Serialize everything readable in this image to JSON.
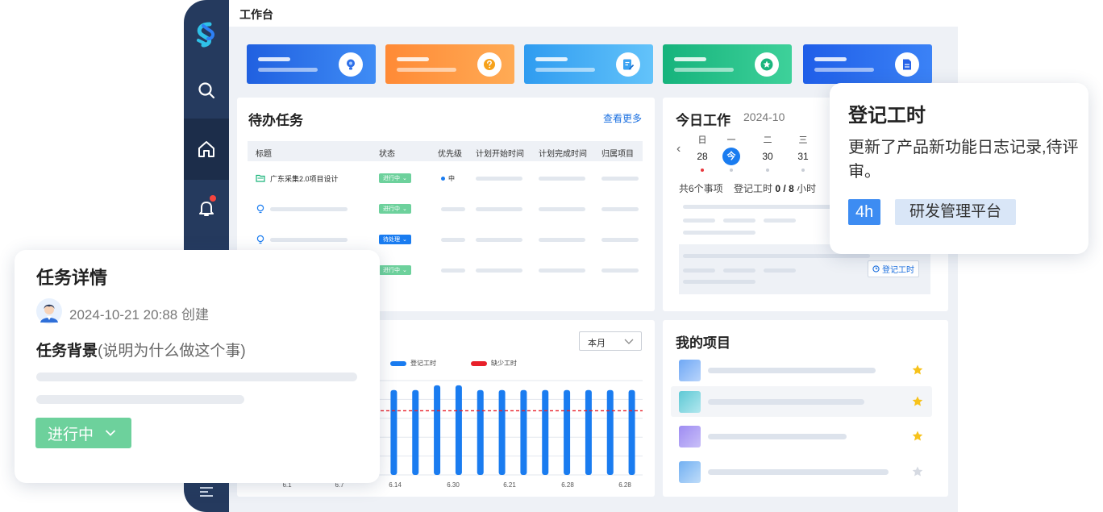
{
  "topbar": {
    "title": "工作台"
  },
  "sidebar": {
    "items": [
      {
        "icon": "search-icon"
      },
      {
        "icon": "home-icon",
        "active": true
      },
      {
        "icon": "bell-icon",
        "has_badge": true
      },
      {
        "icon": "menu-icon"
      }
    ]
  },
  "stat_cards": [
    {
      "color_from": "#2060e0",
      "color_to": "#3f8cf5",
      "icon": "bulb-icon"
    },
    {
      "color_from": "#ff8a36",
      "color_to": "#ffab55",
      "icon": "question-icon"
    },
    {
      "color_from": "#2f9cf0",
      "color_to": "#63c3fa",
      "icon": "edit-doc-icon"
    },
    {
      "color_from": "#16b37c",
      "color_to": "#3ed19a",
      "icon": "star-badge-icon"
    },
    {
      "color_from": "#1f5ee8",
      "color_to": "#3b82f6",
      "icon": "file-icon"
    }
  ],
  "todo": {
    "title": "待办任务",
    "see_more": "查看更多",
    "columns": [
      "标题",
      "状态",
      "优先级",
      "计划开始时间",
      "计划完成时间",
      "归属项目"
    ],
    "rows": [
      {
        "icon": "folder-icon",
        "title": "广东采集2.0项目设计",
        "status": "进行中",
        "status_color": "green",
        "priority": "中"
      },
      {
        "icon": "bulb-icon",
        "title": "",
        "status": "进行中",
        "status_color": "green",
        "priority": ""
      },
      {
        "icon": "bulb-icon",
        "title": "",
        "status": "待处理",
        "status_color": "blue",
        "priority": ""
      },
      {
        "icon": "bulb-icon",
        "title": "",
        "status": "进行中",
        "status_color": "green",
        "priority": ""
      }
    ]
  },
  "today": {
    "title": "今日工作",
    "date": "2024-10",
    "week": [
      {
        "weekday": "日",
        "day": "28",
        "mark": "red"
      },
      {
        "weekday": "一",
        "day": "今",
        "today": true,
        "mark": "gray"
      },
      {
        "weekday": "二",
        "day": "30",
        "mark": "gray"
      },
      {
        "weekday": "三",
        "day": "31",
        "mark": "gray"
      }
    ],
    "summary_count": "共6个事项",
    "summary_log_prefix": "登记工时",
    "summary_log_value": "0 / 8",
    "summary_log_unit": "小时",
    "log_button": "登记工时"
  },
  "chart": {
    "period_select": "本月",
    "chart_data": {
      "type": "bar",
      "categories": [
        "6.1",
        "",
        "6.7",
        "",
        "6.14",
        "",
        "",
        "6.30",
        "",
        "",
        "6.21",
        "",
        "",
        "6.28",
        "",
        "",
        "6.28"
      ],
      "tick_labels": [
        "6.1",
        "6.7",
        "6.14",
        "6.30",
        "6.21",
        "6.28",
        "6.28"
      ],
      "series": [
        {
          "name": "登记工时",
          "color": "#1a7cf0",
          "values": [
            0,
            0,
            0,
            0,
            0,
            9.2,
            9.0,
            9.0,
            9.5,
            9.5,
            9.0,
            9.0,
            9.0,
            9.0,
            9.0,
            9.0,
            9.0,
            9.0
          ]
        },
        {
          "name": "缺少工时",
          "color": "#e8202a",
          "values": [
            0,
            0,
            0,
            0,
            5.5,
            0,
            0,
            0,
            0,
            0,
            0,
            0,
            0,
            0,
            0,
            0,
            0,
            0
          ]
        }
      ],
      "threshold": 6.8,
      "ylim": [
        0,
        10
      ],
      "grid": true,
      "legend": "top"
    }
  },
  "projects": {
    "title": "我的项目",
    "items": [
      {
        "thumb_from": "#6fa8f5",
        "thumb_to": "#b9d4fb",
        "bar_width": 208,
        "starred": true,
        "highlight": false
      },
      {
        "thumb_from": "#5ec9d5",
        "thumb_to": "#b2e7ee",
        "bar_width": 194,
        "starred": true,
        "highlight": true
      },
      {
        "thumb_from": "#9e8cf2",
        "thumb_to": "#c9bff8",
        "bar_width": 172,
        "starred": true,
        "highlight": false
      },
      {
        "thumb_from": "#72b0f2",
        "thumb_to": "#bfdcf9",
        "bar_width": 224,
        "starred": false,
        "highlight": false
      }
    ]
  },
  "log_card": {
    "title": "登记工时",
    "description": "更新了产品新功能日志记录,待评审。",
    "hours": "4h",
    "project": "研发管理平台"
  },
  "task_card": {
    "title": "任务详情",
    "meta": "2024-10-21 20:88 创建",
    "section_label": "任务背景",
    "section_hint": "(说明为什么做这个事)",
    "status": "进行中"
  },
  "colors": {
    "sidebar": "#253a5e",
    "accent": "#1a7cf0",
    "green": "#6dd19c",
    "alert": "#e8202a"
  }
}
